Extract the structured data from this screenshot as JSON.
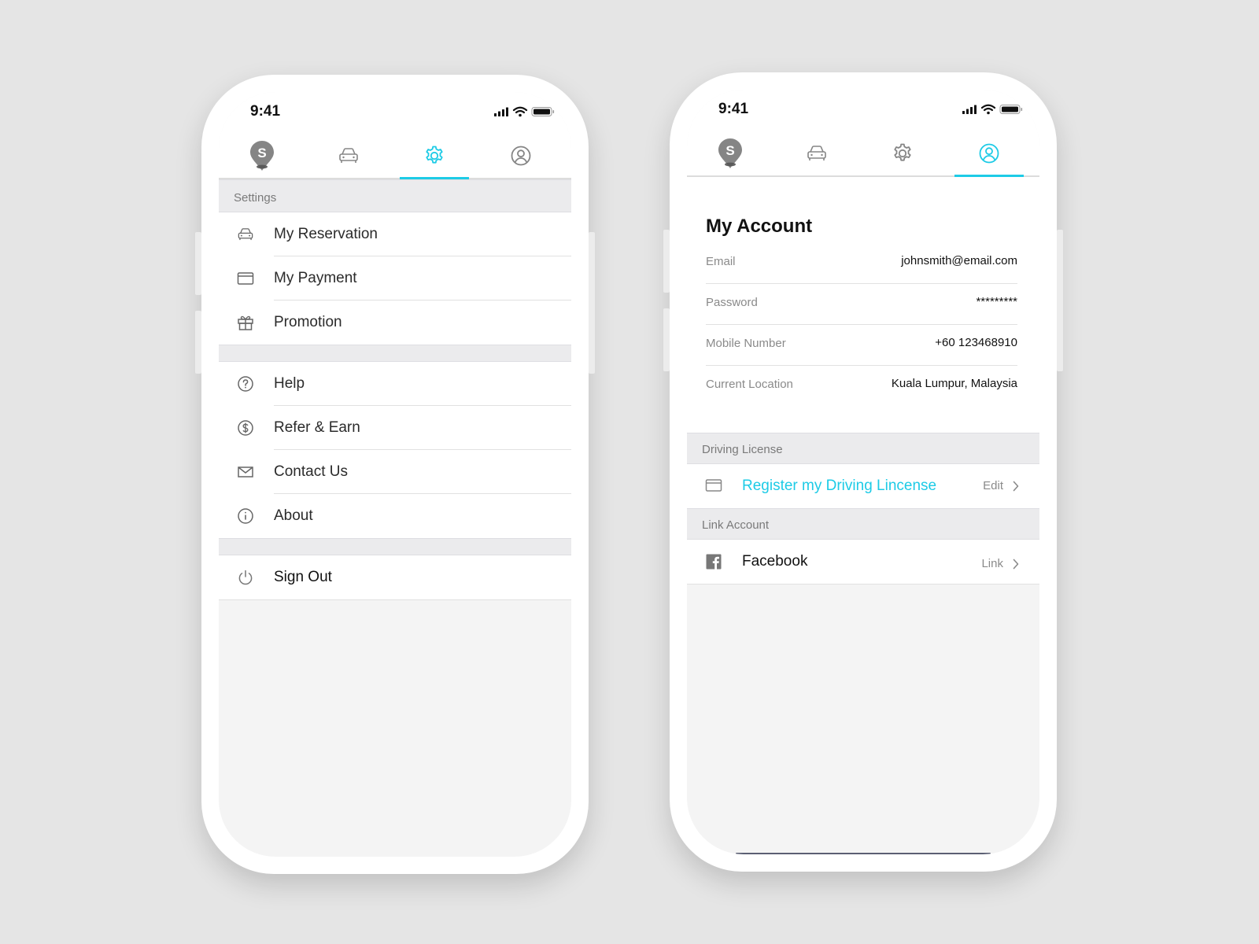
{
  "colors": {
    "accent": "#1dcbe6",
    "background": "#e5e5e5"
  },
  "left_phone": {
    "status": {
      "time": "9:41"
    },
    "tabs": [
      {
        "name": "map-pin-logo",
        "icon": "s-location-pin-icon",
        "active": false
      },
      {
        "name": "car",
        "icon": "car-icon",
        "active": false
      },
      {
        "name": "settings",
        "icon": "gear-icon",
        "active": true
      },
      {
        "name": "profile",
        "icon": "user-circle-icon",
        "active": false
      }
    ],
    "section_title": "Settings",
    "group1": [
      {
        "label": "My Reservation",
        "icon": "car-icon"
      },
      {
        "label": "My Payment",
        "icon": "card-icon"
      },
      {
        "label": "Promotion",
        "icon": "gift-icon"
      }
    ],
    "group2": [
      {
        "label": "Help",
        "icon": "question-circle-icon"
      },
      {
        "label": "Refer & Earn",
        "icon": "dollar-circle-icon"
      },
      {
        "label": "Contact Us",
        "icon": "envelope-icon"
      },
      {
        "label": "About",
        "icon": "info-circle-icon"
      }
    ],
    "group3": [
      {
        "label": "Sign Out",
        "icon": "power-icon"
      }
    ]
  },
  "right_phone": {
    "status": {
      "time": "9:41"
    },
    "tabs": [
      {
        "name": "map-pin-logo",
        "icon": "s-location-pin-icon",
        "active": false
      },
      {
        "name": "car",
        "icon": "car-icon",
        "active": false
      },
      {
        "name": "settings",
        "icon": "gear-icon",
        "active": false
      },
      {
        "name": "profile",
        "icon": "user-circle-icon",
        "active": true
      }
    ],
    "title": "My Account",
    "fields": [
      {
        "key": "Email",
        "value": "johnsmith@email.com"
      },
      {
        "key": "Password",
        "value": "*********"
      },
      {
        "key": "Mobile Number",
        "value": "+60 123468910"
      },
      {
        "key": "Current Location",
        "value": "Kuala Lumpur, Malaysia"
      }
    ],
    "driving_license": {
      "section_title": "Driving License",
      "label": "Register my Driving Lincense",
      "action": "Edit",
      "icon": "card-icon"
    },
    "link_account": {
      "section_title": "Link Account",
      "label": "Facebook",
      "action": "Link",
      "icon": "facebook-icon"
    }
  }
}
